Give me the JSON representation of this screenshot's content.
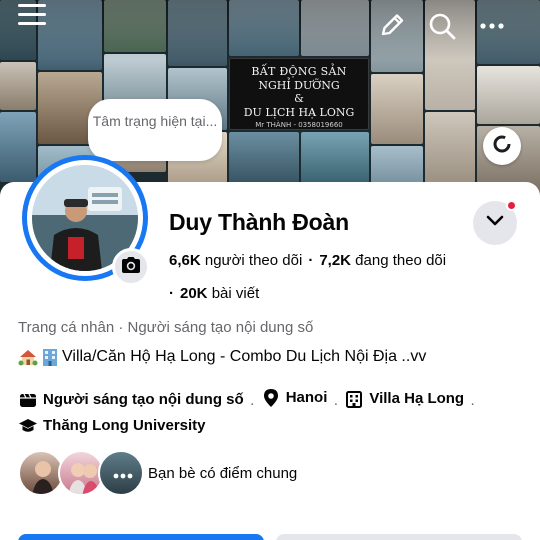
{
  "cover": {
    "banner_lines": [
      "BẤT ĐỘNG SẢN",
      "NGHỈ DƯỠNG",
      "&",
      "DU LỊCH HẠ LONG",
      "Mr THÀNH - 0358019660"
    ]
  },
  "status_bubble": {
    "text": "Tâm trạng hiện tại..."
  },
  "profile": {
    "name": "Duy Thành Đoàn",
    "followers_count": "6,6K",
    "followers_label": "người theo dõi",
    "following_count": "7,2K",
    "following_label": "đang theo dõi",
    "posts_count": "20K",
    "posts_label": "bài viết",
    "category": "Trang cá nhân · Người sáng tạo nội dung số",
    "bio": "Villa/Căn Hộ Hạ Long - Combo Du Lịch Nội Địa ..vv"
  },
  "details": {
    "creator": "Người sáng tạo nội dung số",
    "location": "Hanoi",
    "workplace": "Villa Hạ Long",
    "education": "Thăng Long University",
    "separator": "·"
  },
  "friends": {
    "label": "Bạn bè có điểm chung"
  },
  "colors": {
    "accent": "#1877f2",
    "notification": "#e41e3f",
    "secondary_bg": "#e4e6eb",
    "muted_text": "#65676b"
  },
  "icons": {
    "menu": "hamburger-menu-icon",
    "edit": "pencil-icon",
    "search": "search-icon",
    "more": "more-horizontal-icon",
    "camera": "camera-icon",
    "dropdown": "chevron-down-icon"
  }
}
